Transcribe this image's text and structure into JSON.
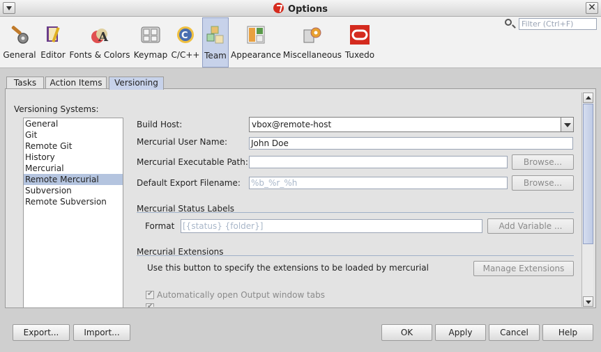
{
  "window": {
    "title": "Options"
  },
  "toolbar": {
    "categories": [
      {
        "label": "General",
        "icon": "wrench-gear-icon"
      },
      {
        "label": "Editor",
        "icon": "book-pencil-icon"
      },
      {
        "label": "Fonts & Colors",
        "icon": "fonts-colors-icon"
      },
      {
        "label": "Keymap",
        "icon": "keyboard-icon"
      },
      {
        "label": "C/C++",
        "icon": "cpp-icon"
      },
      {
        "label": "Team",
        "icon": "team-cubes-icon"
      },
      {
        "label": "Appearance",
        "icon": "appearance-icon"
      },
      {
        "label": "Miscellaneous",
        "icon": "misc-gears-icon"
      },
      {
        "label": "Tuxedo",
        "icon": "tuxedo-icon"
      }
    ],
    "search_placeholder": "Filter (Ctrl+F)"
  },
  "tabs": [
    "Tasks",
    "Action Items",
    "Versioning"
  ],
  "versioning": {
    "label": "Versioning Systems:",
    "items": [
      "General",
      "Git",
      "Remote Git",
      "History",
      "Mercurial",
      "Remote Mercurial",
      "Subversion",
      "Remote Subversion"
    ],
    "selected": "Remote Mercurial"
  },
  "form": {
    "build_host_label": "Build Host:",
    "build_host_value": "vbox@remote-host",
    "user_name_label": "Mercurial User Name:",
    "user_name_value": "John Doe",
    "exec_path_label": "Mercurial Executable Path:",
    "exec_path_value": "",
    "export_label": "Default Export Filename:",
    "export_value": "%b_%r_%h",
    "browse_label": "Browse...",
    "status_section": "Mercurial Status Labels",
    "format_label": "Format",
    "format_value": "[{status} {folder}]",
    "add_variable_label": "Add Variable ...",
    "extensions_section": "Mercurial Extensions",
    "extensions_desc": "Use this button to specify the extensions to be loaded by mercurial",
    "manage_ext_label": "Manage Extensions",
    "auto_open_label": "Automatically open Output window tabs"
  },
  "footer": {
    "export": "Export...",
    "import": "Import...",
    "ok": "OK",
    "apply": "Apply",
    "cancel": "Cancel",
    "help": "Help"
  }
}
